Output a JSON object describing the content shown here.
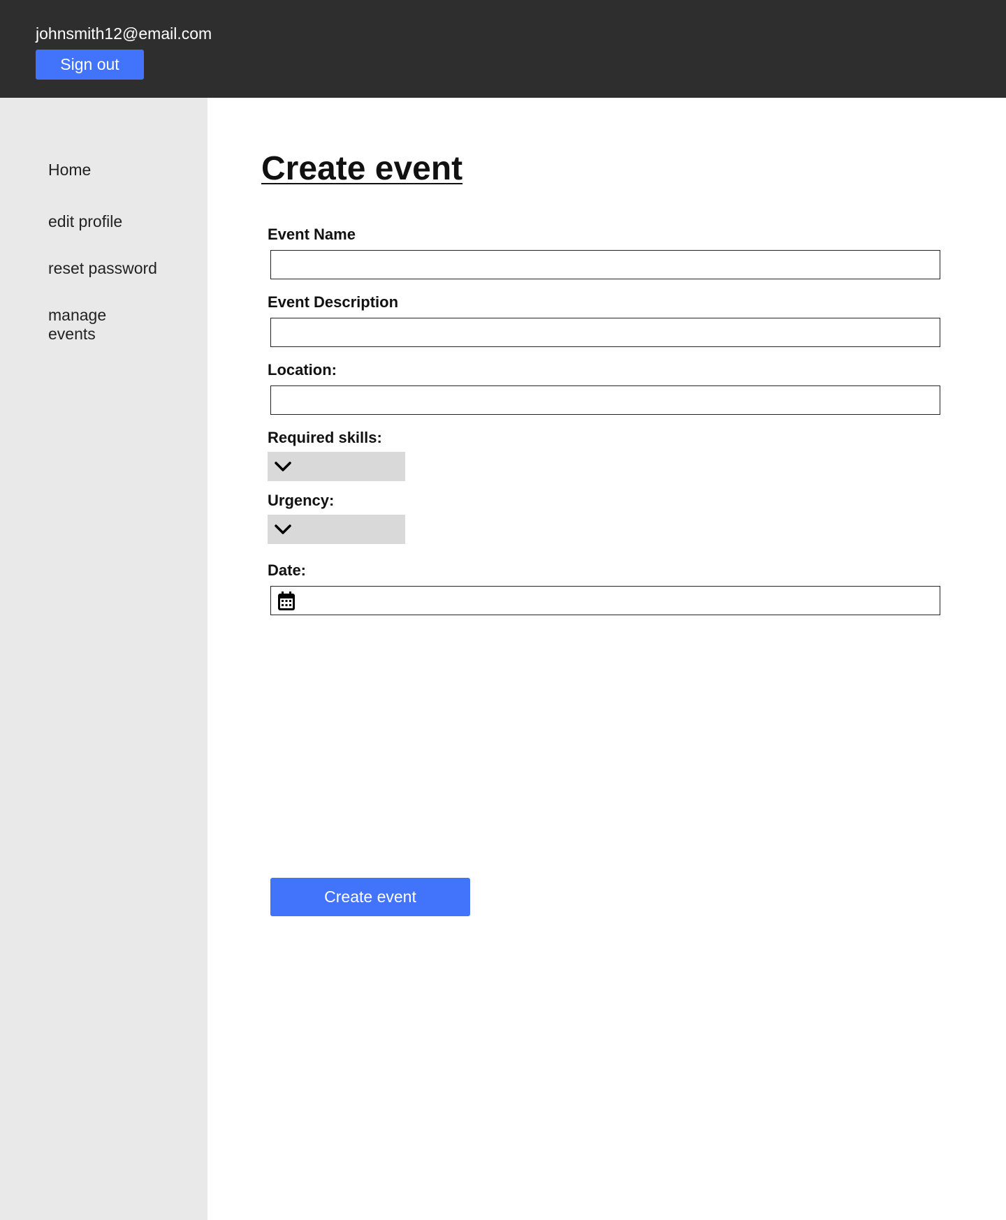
{
  "header": {
    "user_email": "johnsmith12@email.com",
    "sign_out_label": "Sign out"
  },
  "sidebar": {
    "items": [
      {
        "label": "Home"
      },
      {
        "label": "edit profile"
      },
      {
        "label": "reset password"
      },
      {
        "label": "manage events"
      }
    ]
  },
  "main": {
    "title": "Create event",
    "fields": {
      "event_name": {
        "label": "Event Name",
        "value": ""
      },
      "event_description": {
        "label": "Event Description",
        "value": ""
      },
      "location": {
        "label": "Location:",
        "value": ""
      },
      "required_skills": {
        "label": "Required skills:",
        "selected": ""
      },
      "urgency": {
        "label": "Urgency:",
        "selected": ""
      },
      "date": {
        "label": "Date:",
        "value": ""
      }
    },
    "submit_label": "Create event"
  },
  "icons": {
    "dropdown": "chevron-down-icon",
    "date": "calendar-icon"
  },
  "colors": {
    "header_bg": "#2e2e2e",
    "accent": "#4274fb",
    "sidebar_bg": "#e9e9e9",
    "dropdown_bg": "#d9d9d9"
  }
}
